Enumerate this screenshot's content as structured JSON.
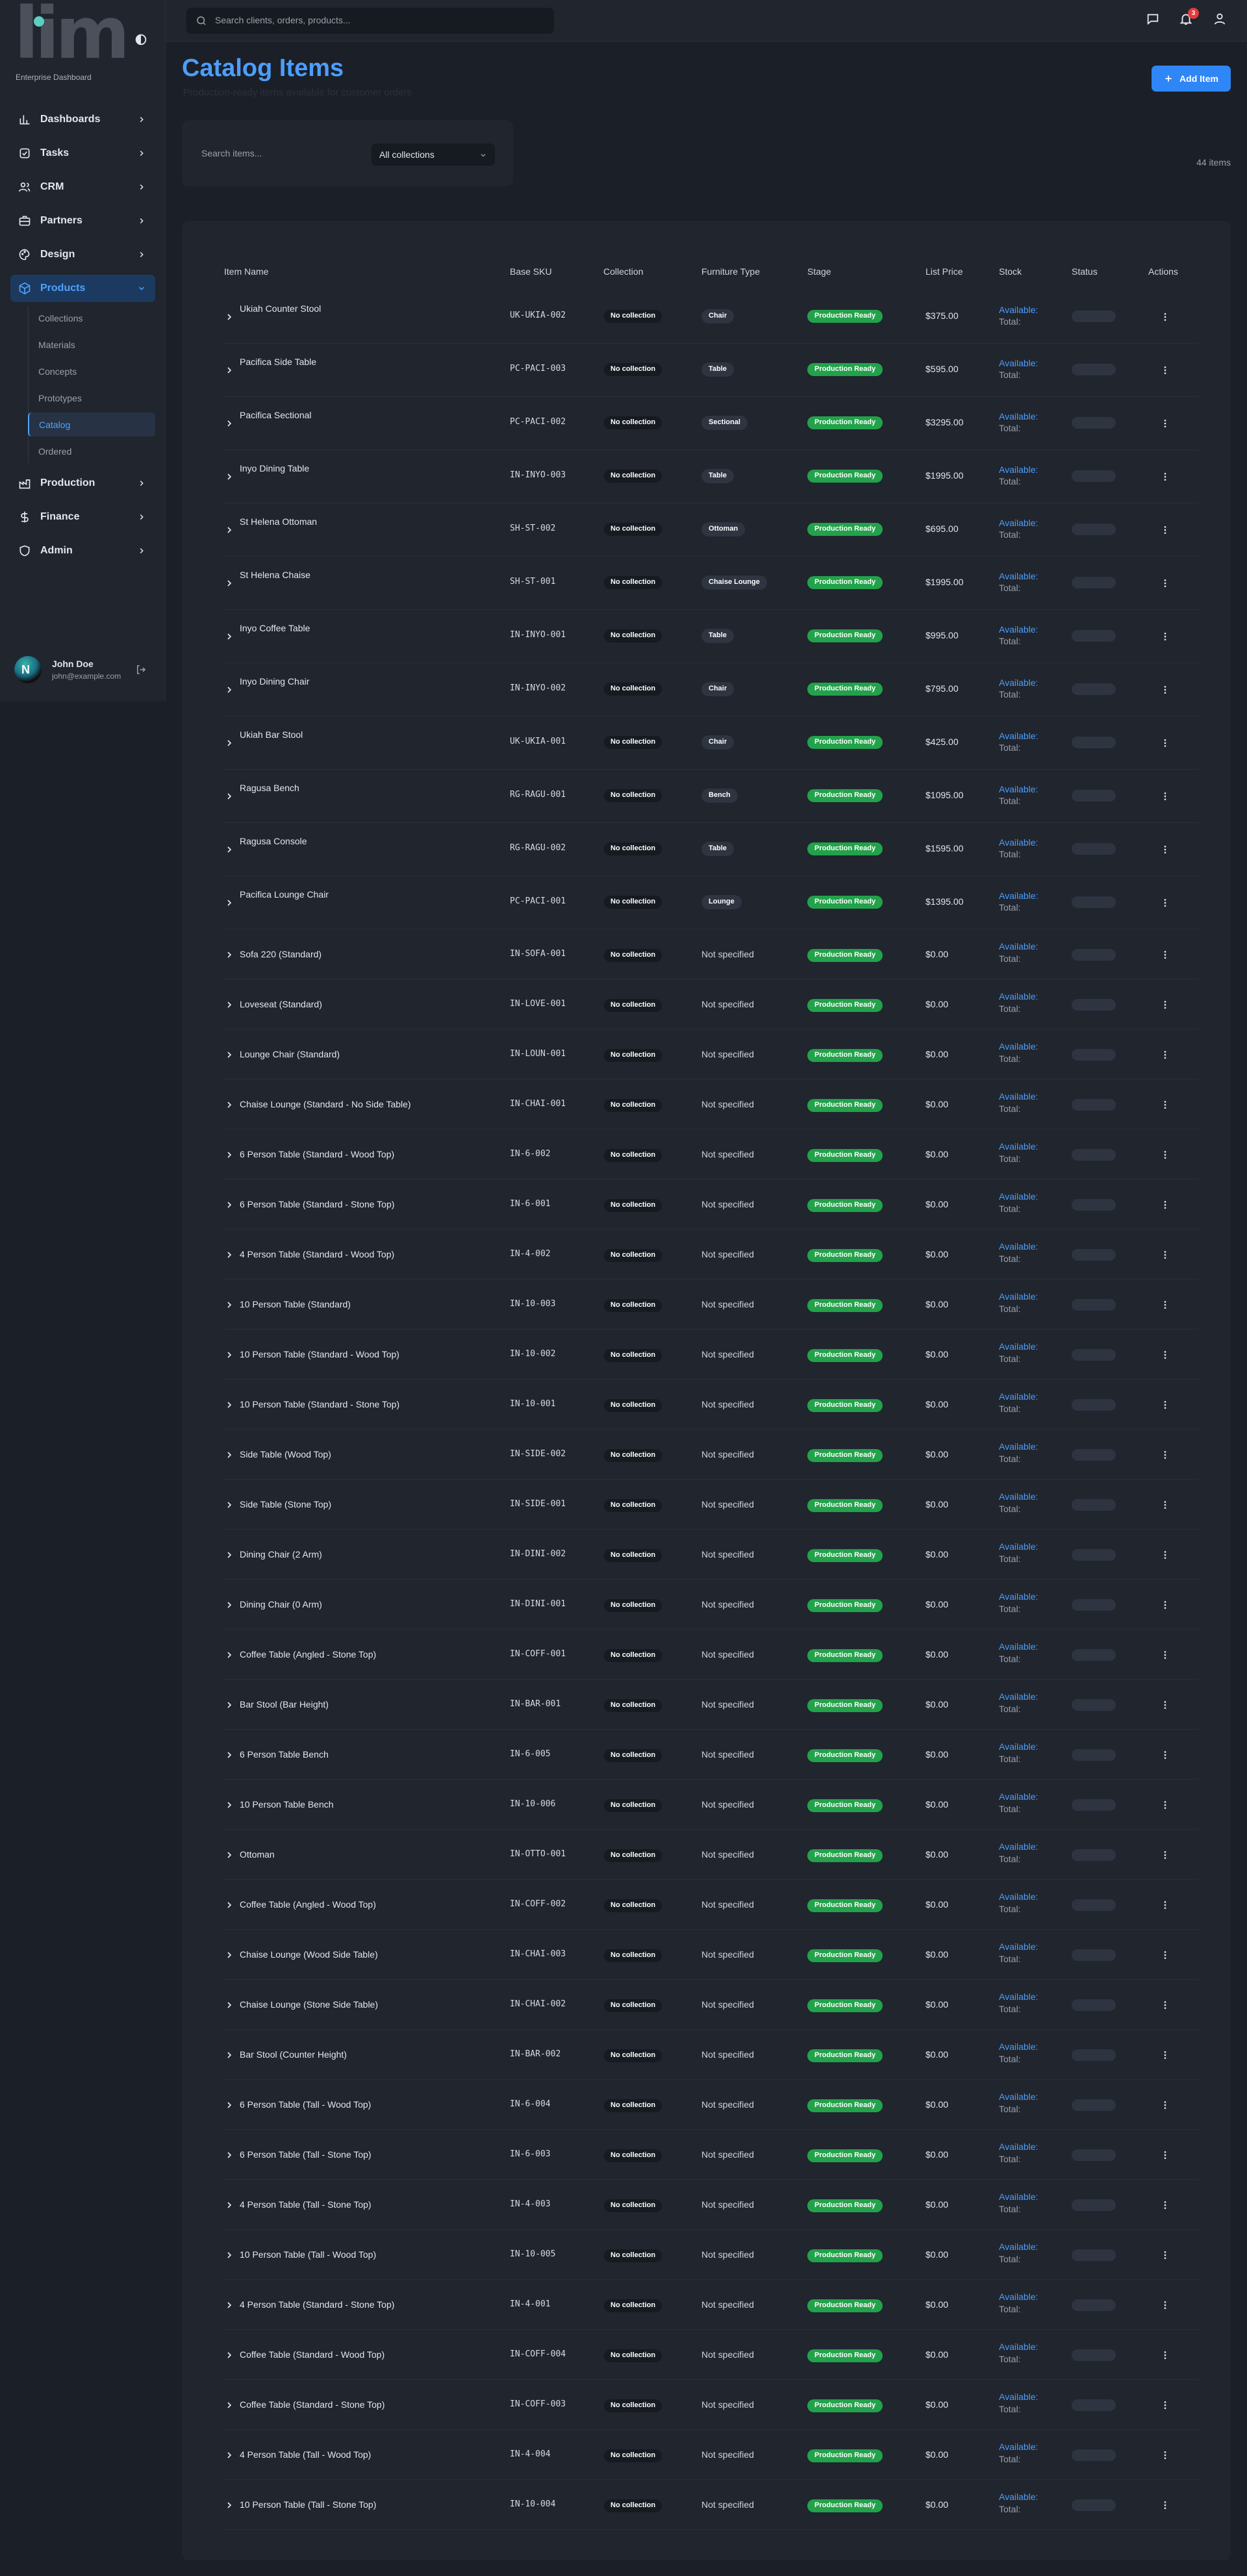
{
  "app": {
    "logo_text": "lim",
    "subtitle": "Enterprise Dashboard",
    "colors": {
      "accent": "#2f86f6",
      "stage_green": "#22a24a",
      "notification_red": "#e5393b"
    }
  },
  "topbar": {
    "search_placeholder": "Search clients, orders, products...",
    "notification_count": "3"
  },
  "sidebar": {
    "items": [
      {
        "label": "Dashboards",
        "icon": "chart-bar-icon"
      },
      {
        "label": "Tasks",
        "icon": "checkbox-icon"
      },
      {
        "label": "CRM",
        "icon": "users-icon"
      },
      {
        "label": "Partners",
        "icon": "briefcase-icon"
      },
      {
        "label": "Design",
        "icon": "palette-icon"
      },
      {
        "label": "Products",
        "icon": "package-icon",
        "active": true
      },
      {
        "label": "Production",
        "icon": "factory-icon"
      },
      {
        "label": "Finance",
        "icon": "dollar-icon"
      },
      {
        "label": "Admin",
        "icon": "shield-icon"
      }
    ],
    "products_sub": [
      {
        "label": "Collections"
      },
      {
        "label": "Materials"
      },
      {
        "label": "Concepts"
      },
      {
        "label": "Prototypes"
      },
      {
        "label": "Catalog",
        "active": true
      },
      {
        "label": "Ordered"
      }
    ],
    "user": {
      "initial": "N",
      "name": "John Doe",
      "email": "john@example.com"
    }
  },
  "page": {
    "title": "Catalog Items",
    "subtitle": "Production-ready items available for customer orders",
    "add_button": "Add Item",
    "search_placeholder": "Search items...",
    "collection_filter": "All collections",
    "item_count": "44 items"
  },
  "table": {
    "headers": [
      "Item Name",
      "Base SKU",
      "Collection",
      "Furniture Type",
      "Stage",
      "List Price",
      "Stock",
      "Status",
      "Actions"
    ],
    "stock_available_label": "Available:",
    "stock_total_label": "Total:",
    "rows": [
      {
        "name": "Ukiah Counter Stool",
        "sku": "UK-UKIA-002",
        "collection": "No collection",
        "type": "Chair",
        "typed": true,
        "stage": "Production Ready",
        "price": "$375.00"
      },
      {
        "name": "Pacifica Side Table",
        "sku": "PC-PACI-003",
        "collection": "No collection",
        "type": "Table",
        "typed": true,
        "stage": "Production Ready",
        "price": "$595.00"
      },
      {
        "name": "Pacifica Sectional",
        "sku": "PC-PACI-002",
        "collection": "No collection",
        "type": "Sectional",
        "typed": true,
        "stage": "Production Ready",
        "price": "$3295.00"
      },
      {
        "name": "Inyo Dining Table",
        "sku": "IN-INYO-003",
        "collection": "No collection",
        "type": "Table",
        "typed": true,
        "stage": "Production Ready",
        "price": "$1995.00"
      },
      {
        "name": "St Helena Ottoman",
        "sku": "SH-ST-002",
        "collection": "No collection",
        "type": "Ottoman",
        "typed": true,
        "stage": "Production Ready",
        "price": "$695.00"
      },
      {
        "name": "St Helena Chaise",
        "sku": "SH-ST-001",
        "collection": "No collection",
        "type": "Chaise Lounge",
        "typed": true,
        "stage": "Production Ready",
        "price": "$1995.00"
      },
      {
        "name": "Inyo Coffee Table",
        "sku": "IN-INYO-001",
        "collection": "No collection",
        "type": "Table",
        "typed": true,
        "stage": "Production Ready",
        "price": "$995.00"
      },
      {
        "name": "Inyo Dining Chair",
        "sku": "IN-INYO-002",
        "collection": "No collection",
        "type": "Chair",
        "typed": true,
        "stage": "Production Ready",
        "price": "$795.00"
      },
      {
        "name": "Ukiah Bar Stool",
        "sku": "UK-UKIA-001",
        "collection": "No collection",
        "type": "Chair",
        "typed": true,
        "stage": "Production Ready",
        "price": "$425.00"
      },
      {
        "name": "Ragusa Bench",
        "sku": "RG-RAGU-001",
        "collection": "No collection",
        "type": "Bench",
        "typed": true,
        "stage": "Production Ready",
        "price": "$1095.00"
      },
      {
        "name": "Ragusa Console",
        "sku": "RG-RAGU-002",
        "collection": "No collection",
        "type": "Table",
        "typed": true,
        "stage": "Production Ready",
        "price": "$1595.00"
      },
      {
        "name": "Pacifica Lounge Chair",
        "sku": "PC-PACI-001",
        "collection": "No collection",
        "type": "Lounge",
        "typed": true,
        "stage": "Production Ready",
        "price": "$1395.00"
      },
      {
        "name": "Sofa 220 (Standard)",
        "sku": "IN-SOFA-001",
        "collection": "No collection",
        "type": "Not specified",
        "typed": false,
        "stage": "Production Ready",
        "price": "$0.00"
      },
      {
        "name": "Loveseat (Standard)",
        "sku": "IN-LOVE-001",
        "collection": "No collection",
        "type": "Not specified",
        "typed": false,
        "stage": "Production Ready",
        "price": "$0.00"
      },
      {
        "name": "Lounge Chair (Standard)",
        "sku": "IN-LOUN-001",
        "collection": "No collection",
        "type": "Not specified",
        "typed": false,
        "stage": "Production Ready",
        "price": "$0.00"
      },
      {
        "name": "Chaise Lounge (Standard - No Side Table)",
        "sku": "IN-CHAI-001",
        "collection": "No collection",
        "type": "Not specified",
        "typed": false,
        "stage": "Production Ready",
        "price": "$0.00"
      },
      {
        "name": "6 Person Table (Standard - Wood Top)",
        "sku": "IN-6-002",
        "collection": "No collection",
        "type": "Not specified",
        "typed": false,
        "stage": "Production Ready",
        "price": "$0.00"
      },
      {
        "name": "6 Person Table (Standard - Stone Top)",
        "sku": "IN-6-001",
        "collection": "No collection",
        "type": "Not specified",
        "typed": false,
        "stage": "Production Ready",
        "price": "$0.00"
      },
      {
        "name": "4 Person Table (Standard - Wood Top)",
        "sku": "IN-4-002",
        "collection": "No collection",
        "type": "Not specified",
        "typed": false,
        "stage": "Production Ready",
        "price": "$0.00"
      },
      {
        "name": "10 Person Table (Standard)",
        "sku": "IN-10-003",
        "collection": "No collection",
        "type": "Not specified",
        "typed": false,
        "stage": "Production Ready",
        "price": "$0.00"
      },
      {
        "name": "10 Person Table (Standard - Wood Top)",
        "sku": "IN-10-002",
        "collection": "No collection",
        "type": "Not specified",
        "typed": false,
        "stage": "Production Ready",
        "price": "$0.00"
      },
      {
        "name": "10 Person Table (Standard - Stone Top)",
        "sku": "IN-10-001",
        "collection": "No collection",
        "type": "Not specified",
        "typed": false,
        "stage": "Production Ready",
        "price": "$0.00"
      },
      {
        "name": "Side Table (Wood Top)",
        "sku": "IN-SIDE-002",
        "collection": "No collection",
        "type": "Not specified",
        "typed": false,
        "stage": "Production Ready",
        "price": "$0.00"
      },
      {
        "name": "Side Table (Stone Top)",
        "sku": "IN-SIDE-001",
        "collection": "No collection",
        "type": "Not specified",
        "typed": false,
        "stage": "Production Ready",
        "price": "$0.00"
      },
      {
        "name": "Dining Chair (2 Arm)",
        "sku": "IN-DINI-002",
        "collection": "No collection",
        "type": "Not specified",
        "typed": false,
        "stage": "Production Ready",
        "price": "$0.00"
      },
      {
        "name": "Dining Chair (0 Arm)",
        "sku": "IN-DINI-001",
        "collection": "No collection",
        "type": "Not specified",
        "typed": false,
        "stage": "Production Ready",
        "price": "$0.00"
      },
      {
        "name": "Coffee Table (Angled - Stone Top)",
        "sku": "IN-COFF-001",
        "collection": "No collection",
        "type": "Not specified",
        "typed": false,
        "stage": "Production Ready",
        "price": "$0.00"
      },
      {
        "name": "Bar Stool (Bar Height)",
        "sku": "IN-BAR-001",
        "collection": "No collection",
        "type": "Not specified",
        "typed": false,
        "stage": "Production Ready",
        "price": "$0.00"
      },
      {
        "name": "6 Person Table Bench",
        "sku": "IN-6-005",
        "collection": "No collection",
        "type": "Not specified",
        "typed": false,
        "stage": "Production Ready",
        "price": "$0.00"
      },
      {
        "name": "10 Person Table Bench",
        "sku": "IN-10-006",
        "collection": "No collection",
        "type": "Not specified",
        "typed": false,
        "stage": "Production Ready",
        "price": "$0.00"
      },
      {
        "name": "Ottoman",
        "sku": "IN-OTTO-001",
        "collection": "No collection",
        "type": "Not specified",
        "typed": false,
        "stage": "Production Ready",
        "price": "$0.00"
      },
      {
        "name": "Coffee Table (Angled - Wood Top)",
        "sku": "IN-COFF-002",
        "collection": "No collection",
        "type": "Not specified",
        "typed": false,
        "stage": "Production Ready",
        "price": "$0.00"
      },
      {
        "name": "Chaise Lounge (Wood Side Table)",
        "sku": "IN-CHAI-003",
        "collection": "No collection",
        "type": "Not specified",
        "typed": false,
        "stage": "Production Ready",
        "price": "$0.00"
      },
      {
        "name": "Chaise Lounge (Stone Side Table)",
        "sku": "IN-CHAI-002",
        "collection": "No collection",
        "type": "Not specified",
        "typed": false,
        "stage": "Production Ready",
        "price": "$0.00"
      },
      {
        "name": "Bar Stool (Counter Height)",
        "sku": "IN-BAR-002",
        "collection": "No collection",
        "type": "Not specified",
        "typed": false,
        "stage": "Production Ready",
        "price": "$0.00"
      },
      {
        "name": "6 Person Table (Tall - Wood Top)",
        "sku": "IN-6-004",
        "collection": "No collection",
        "type": "Not specified",
        "typed": false,
        "stage": "Production Ready",
        "price": "$0.00"
      },
      {
        "name": "6 Person Table (Tall - Stone Top)",
        "sku": "IN-6-003",
        "collection": "No collection",
        "type": "Not specified",
        "typed": false,
        "stage": "Production Ready",
        "price": "$0.00"
      },
      {
        "name": "4 Person Table (Tall - Stone Top)",
        "sku": "IN-4-003",
        "collection": "No collection",
        "type": "Not specified",
        "typed": false,
        "stage": "Production Ready",
        "price": "$0.00"
      },
      {
        "name": "10 Person Table (Tall - Wood Top)",
        "sku": "IN-10-005",
        "collection": "No collection",
        "type": "Not specified",
        "typed": false,
        "stage": "Production Ready",
        "price": "$0.00"
      },
      {
        "name": "4 Person Table (Standard - Stone Top)",
        "sku": "IN-4-001",
        "collection": "No collection",
        "type": "Not specified",
        "typed": false,
        "stage": "Production Ready",
        "price": "$0.00"
      },
      {
        "name": "Coffee Table (Standard - Wood Top)",
        "sku": "IN-COFF-004",
        "collection": "No collection",
        "type": "Not specified",
        "typed": false,
        "stage": "Production Ready",
        "price": "$0.00"
      },
      {
        "name": "Coffee Table (Standard - Stone Top)",
        "sku": "IN-COFF-003",
        "collection": "No collection",
        "type": "Not specified",
        "typed": false,
        "stage": "Production Ready",
        "price": "$0.00"
      },
      {
        "name": "4 Person Table (Tall - Wood Top)",
        "sku": "IN-4-004",
        "collection": "No collection",
        "type": "Not specified",
        "typed": false,
        "stage": "Production Ready",
        "price": "$0.00"
      },
      {
        "name": "10 Person Table (Tall - Stone Top)",
        "sku": "IN-10-004",
        "collection": "No collection",
        "type": "Not specified",
        "typed": false,
        "stage": "Production Ready",
        "price": "$0.00"
      }
    ]
  }
}
